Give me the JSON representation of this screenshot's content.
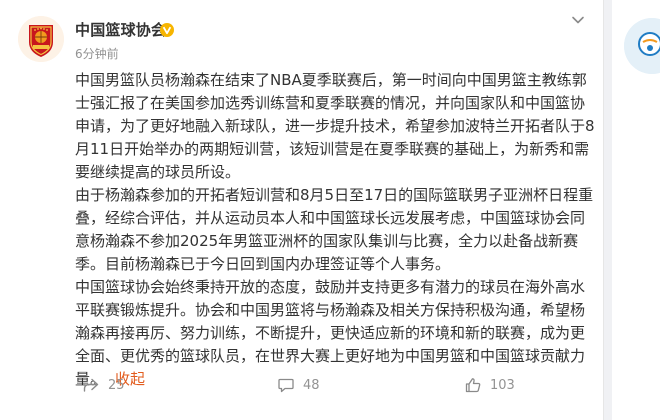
{
  "post": {
    "username": "中国篮球协会",
    "timestamp": "6分钟前",
    "paragraphs": [
      "中国男篮队员杨瀚森在结束了NBA夏季联赛后，第一时间向中国男篮主教练郭士强汇报了在美国参加选秀训练营和夏季联赛的情况，并向国家队和中国篮协申请，为了更好地融入新球队，进一步提升技术，希望参加波特兰开拓者队于8月11日开始举办的两期短训营，该短训营是在夏季联赛的基础上，为新秀和需要继续提高的球员所设。",
      "由于杨瀚森参加的开拓者短训营和8月5日至17日的国际篮联男子亚洲杯日程重叠，经综合评估，并从运动员本人和中国篮球长远发展考虑，中国篮球协会同意杨瀚森不参加2025年男篮亚洲杯的国家队集训与比赛，全力以赴备战新赛季。目前杨瀚森已于今日回到国内办理签证等个人事务。",
      "中国篮球协会始终秉持开放的态度，鼓励并支持更多有潜力的球员在海外高水平联赛锻炼提升。协会和中国男篮将与杨瀚森及相关方保持积极沟通，希望杨瀚森再接再厉、努力训练，不断提升，更快适应新的环境和新的联赛，成为更全面、更优秀的篮球队员，在世界大赛上更好地为中国男篮和中国篮球贡献力量。"
    ],
    "collapse_label": "收起",
    "forward_count": "25",
    "comment_count": "48",
    "like_count": "103"
  },
  "colors": {
    "link": "#e25c1e",
    "muted": "#939393",
    "text": "#333333",
    "verified_badge": "#f7b500"
  },
  "icons": {
    "avatar": "chinese-basketball-association-logo",
    "verified": "verified-v-icon",
    "menu": "chevron-down-icon",
    "forward": "forward-icon",
    "comment": "comment-icon",
    "like": "thumbs-up-icon"
  }
}
